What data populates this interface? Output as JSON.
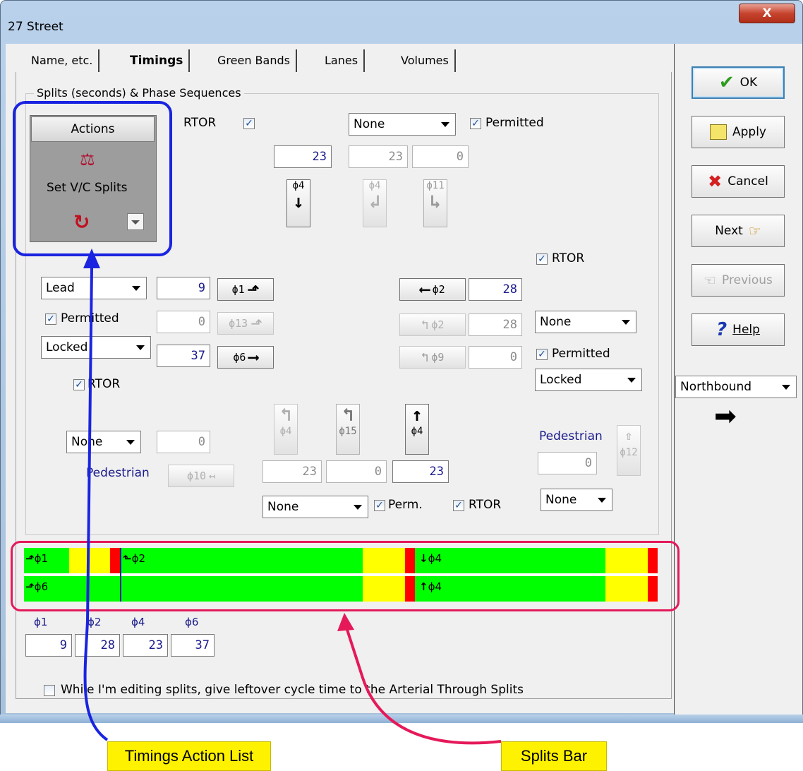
{
  "window": {
    "title": "27 Street",
    "close_glyph": "X"
  },
  "tabs": [
    {
      "label": "Name, etc.",
      "active": false
    },
    {
      "label": "Timings",
      "active": true
    },
    {
      "label": "Green Bands",
      "active": false
    },
    {
      "label": "Lanes",
      "active": false
    },
    {
      "label": "Volumes",
      "active": false
    }
  ],
  "side_buttons": {
    "ok": "OK",
    "apply": "Apply",
    "cancel": "Cancel",
    "next": "Next",
    "previous": "Previous",
    "help": "Help"
  },
  "direction_select": {
    "value": "Northbound",
    "arrow": "➡"
  },
  "group_title": "Splits (seconds) & Phase Sequences",
  "actions": {
    "header": "Actions",
    "label": "Set V/C Splits",
    "balance_glyph": "⚖",
    "refresh_glyph": "↻"
  },
  "north": {
    "rtor_label": "RTOR",
    "select": "None",
    "permitted": "Permitted",
    "split_main": "23",
    "split_b": "23",
    "split_c": "0",
    "phase_main": "ϕ4",
    "phase_b": "ϕ4",
    "phase_c": "ϕ11",
    "glyph_main": "↓",
    "glyph_b": "↲",
    "glyph_c": "↳"
  },
  "west": {
    "sequence": "Lead",
    "permitted": "Permitted",
    "lock": "Locked",
    "rtor": "RTOR",
    "split_1": "9",
    "split_13": "0",
    "split_6": "37",
    "phase_1": "ϕ1",
    "phase_13": "ϕ13",
    "phase_6": "ϕ6",
    "glyph_1": "⬏",
    "glyph_13": "⬏",
    "glyph_6": "⟶",
    "ped_select": "None",
    "ped_value": "0",
    "ped_label": "Pedestrian",
    "ped_phase": "ϕ10",
    "ped_glyph": "↤"
  },
  "east": {
    "rtor": "RTOR",
    "select": "None",
    "permitted": "Permitted",
    "lock": "Locked",
    "split_2": "28",
    "split_2b": "28",
    "split_9": "0",
    "phase_2": "ϕ2",
    "phase_2b": "ϕ2",
    "phase_9": "ϕ9",
    "glyph_2": "⟵",
    "glyph_2b": "↰",
    "glyph_9": "↰",
    "ped_label": "Pedestrian",
    "ped_value": "0",
    "ped_phase": "ϕ12",
    "ped_select": "None"
  },
  "south": {
    "phase_a": "ϕ4",
    "phase_b": "ϕ15",
    "phase_c": "ϕ4",
    "glyph_a": "↰",
    "glyph_b": "↰",
    "glyph_c": "↑",
    "split_a": "23",
    "split_b": "0",
    "split_c": "23",
    "select": "None",
    "perm": "Perm.",
    "rtor": "RTOR"
  },
  "splits_bar": {
    "ring1": [
      {
        "label": "ϕ1",
        "glyph": "⬏"
      },
      {
        "label": "ϕ2",
        "glyph": "⬑"
      },
      {
        "label": "ϕ4",
        "glyph": "↓"
      }
    ],
    "ring2": [
      {
        "label": "ϕ6",
        "glyph": "⬏"
      },
      {
        "label": "ϕ4",
        "glyph": "↑"
      }
    ]
  },
  "split_summary": {
    "headers": [
      "ϕ1",
      "ϕ2",
      "ϕ4",
      "ϕ6"
    ],
    "values": [
      "9",
      "28",
      "23",
      "37"
    ]
  },
  "leftover_checkbox": "While I'm editing splits, give leftover cycle time to the Arterial Through Splits",
  "callouts": {
    "actions": "Timings Action List",
    "splits": "Splits Bar"
  },
  "colors": {
    "green": "#00ff00",
    "yellow": "#ffff00",
    "red": "#ff0000",
    "blue_highlight": "#1a24e0",
    "pink_highlight": "#e5195a",
    "callout": "#fff200"
  }
}
